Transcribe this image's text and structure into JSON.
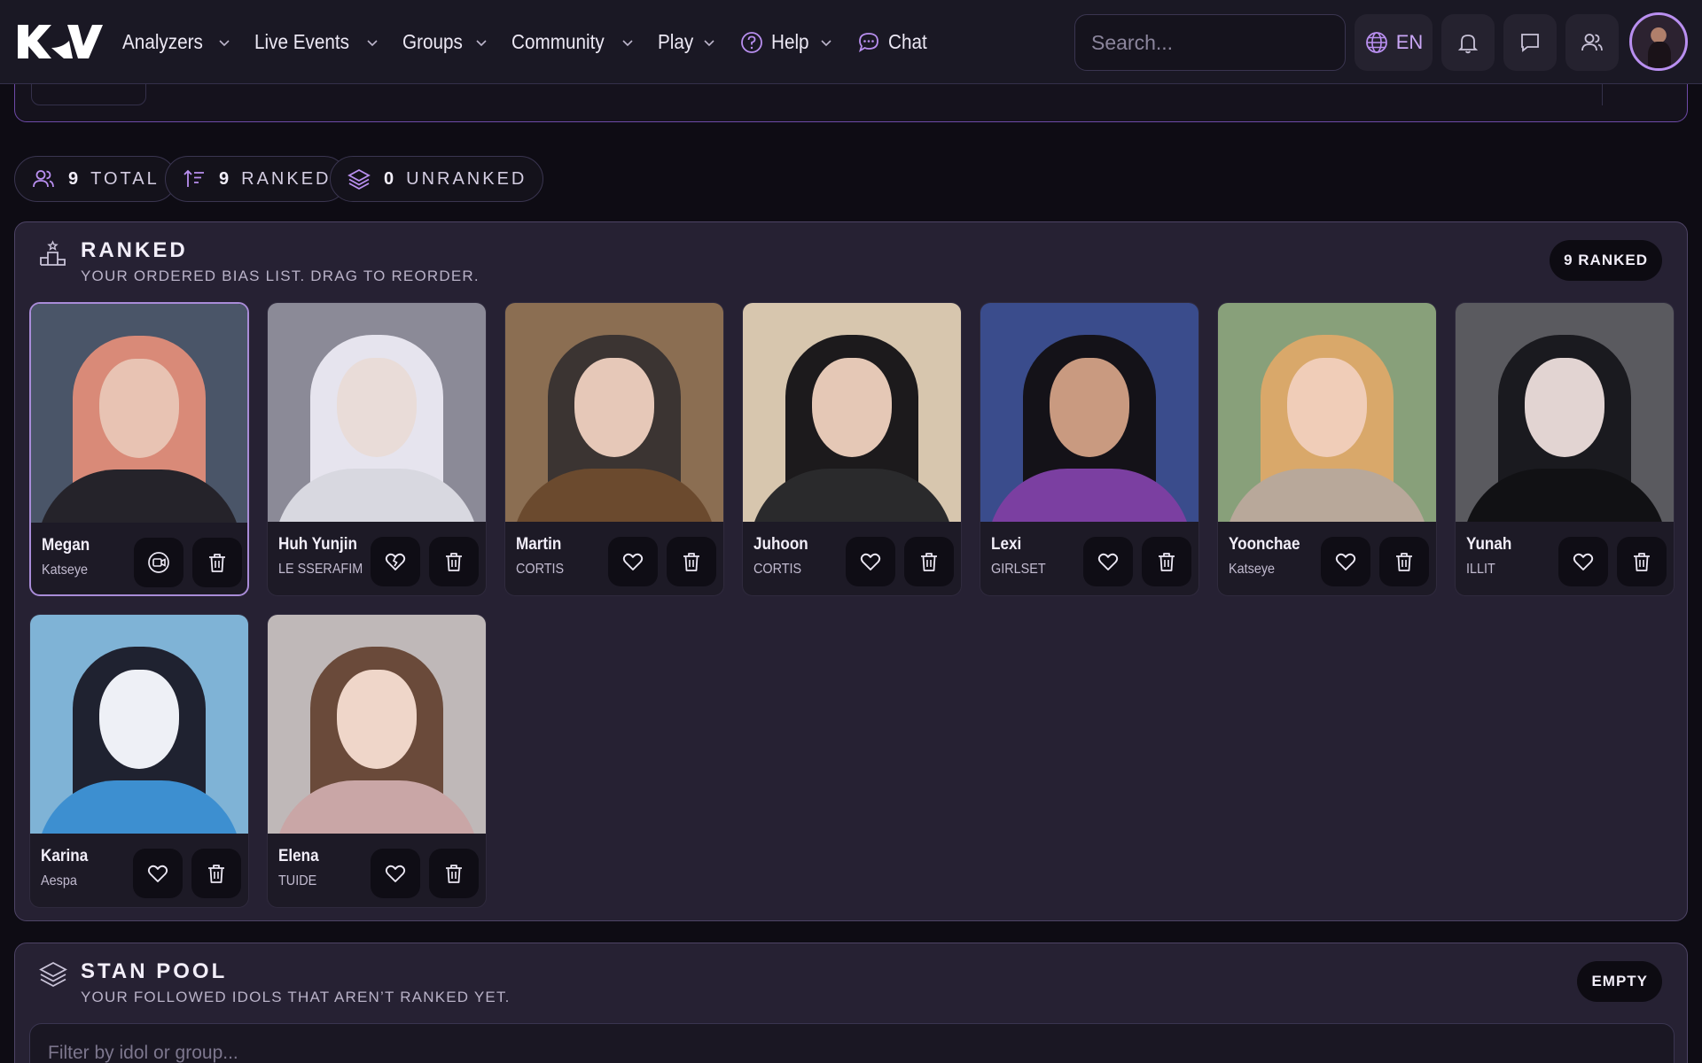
{
  "nav": {
    "items": [
      {
        "label": "Analyzers",
        "has_menu": true
      },
      {
        "label": "Live Events",
        "has_menu": true
      },
      {
        "label": "Groups",
        "has_menu": true
      },
      {
        "label": "Community",
        "has_menu": true
      },
      {
        "label": "Play",
        "has_menu": true
      },
      {
        "label": "Help",
        "has_menu": true,
        "icon": "help-circle-icon"
      },
      {
        "label": "Chat",
        "has_menu": false,
        "icon": "chat-bubble-icon"
      }
    ],
    "search_placeholder": "Search...",
    "language": "EN"
  },
  "counters": {
    "total": {
      "num": "9",
      "label": "TOTAL"
    },
    "ranked": {
      "num": "9",
      "label": "RANKED"
    },
    "unranked": {
      "num": "0",
      "label": "UNRANKED"
    }
  },
  "ranked": {
    "title": "RANKED",
    "subtitle": "YOUR ORDERED BIAS LIST. DRAG TO REORDER.",
    "badge": "9 RANKED",
    "idols": [
      {
        "name": "Megan",
        "group": "Katseye",
        "hair": "#d98a78",
        "skin": "#e8c3b3",
        "bg": "#4a5568",
        "body": "#25232a"
      },
      {
        "name": "Huh Yunjin",
        "group": "LE SSERAFIM",
        "hair": "#e6e4ee",
        "skin": "#e9dcd8",
        "bg": "#8b8a97",
        "body": "#d8d8e0"
      },
      {
        "name": "Martin",
        "group": "CORTIS",
        "hair": "#3b3432",
        "skin": "#e6c8b8",
        "bg": "#8b6e52",
        "body": "#6b4a2e"
      },
      {
        "name": "Juhoon",
        "group": "CORTIS",
        "hair": "#1c1a1c",
        "skin": "#e5c8b6",
        "bg": "#d7c6ae",
        "body": "#2a2a2c"
      },
      {
        "name": "Lexi",
        "group": "GIRLSET",
        "hair": "#141218",
        "skin": "#c99a80",
        "bg": "#3a4c8c",
        "body": "#7b3fa1"
      },
      {
        "name": "Yoonchae",
        "group": "Katseye",
        "hair": "#d9a86a",
        "skin": "#f0cdb8",
        "bg": "#88a07a",
        "body": "#b8a89a"
      },
      {
        "name": "Yunah",
        "group": "ILLIT",
        "hair": "#1a1a1f",
        "skin": "#e2d4d2",
        "bg": "#5a5a5f",
        "body": "#111114"
      },
      {
        "name": "Karina",
        "group": "Aespa",
        "hair": "#1f2230",
        "skin": "#eef0f6",
        "bg": "#7fb3d6",
        "body": "#3d8fd0"
      },
      {
        "name": "Elena",
        "group": "TUIDE",
        "hair": "#6a4a3a",
        "skin": "#efd6c9",
        "bg": "#bfb8b8",
        "body": "#c9a6a6"
      }
    ]
  },
  "pool": {
    "title": "STAN POOL",
    "subtitle": "YOUR FOLLOWED IDOLS THAT AREN’T RANKED YET.",
    "badge": "EMPTY",
    "filter_placeholder": "Filter by idol or group..."
  }
}
